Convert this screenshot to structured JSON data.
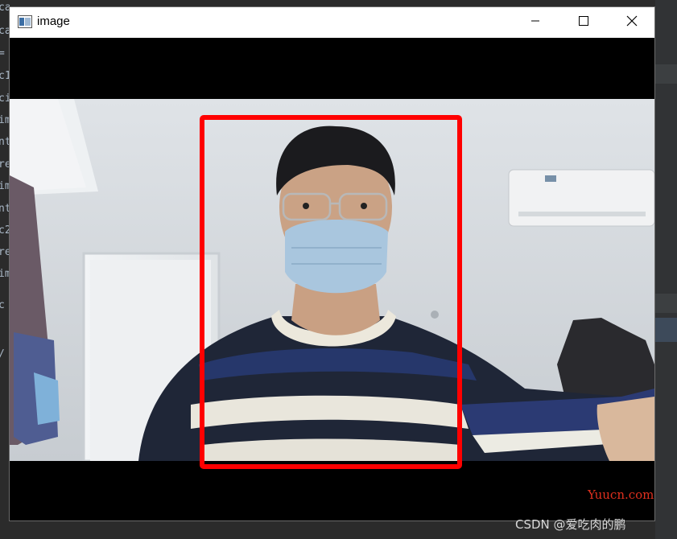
{
  "window": {
    "title": "image"
  },
  "detection": {
    "box_color": "#ff0000"
  },
  "background_code_fragments": [
    "ca",
    "ca",
    "=",
    "c1",
    "ci",
    "im",
    "nt",
    "re",
    "im",
    "nt",
    "c2",
    "re",
    "im",
    "c",
    "/"
  ],
  "watermarks": {
    "site": "Yuucn.com",
    "author": "CSDN @爱吃肉的鹏"
  },
  "icons": {
    "app": "opencv-window-icon",
    "minimize": "minimize-icon",
    "maximize": "maximize-icon",
    "close": "close-icon"
  }
}
